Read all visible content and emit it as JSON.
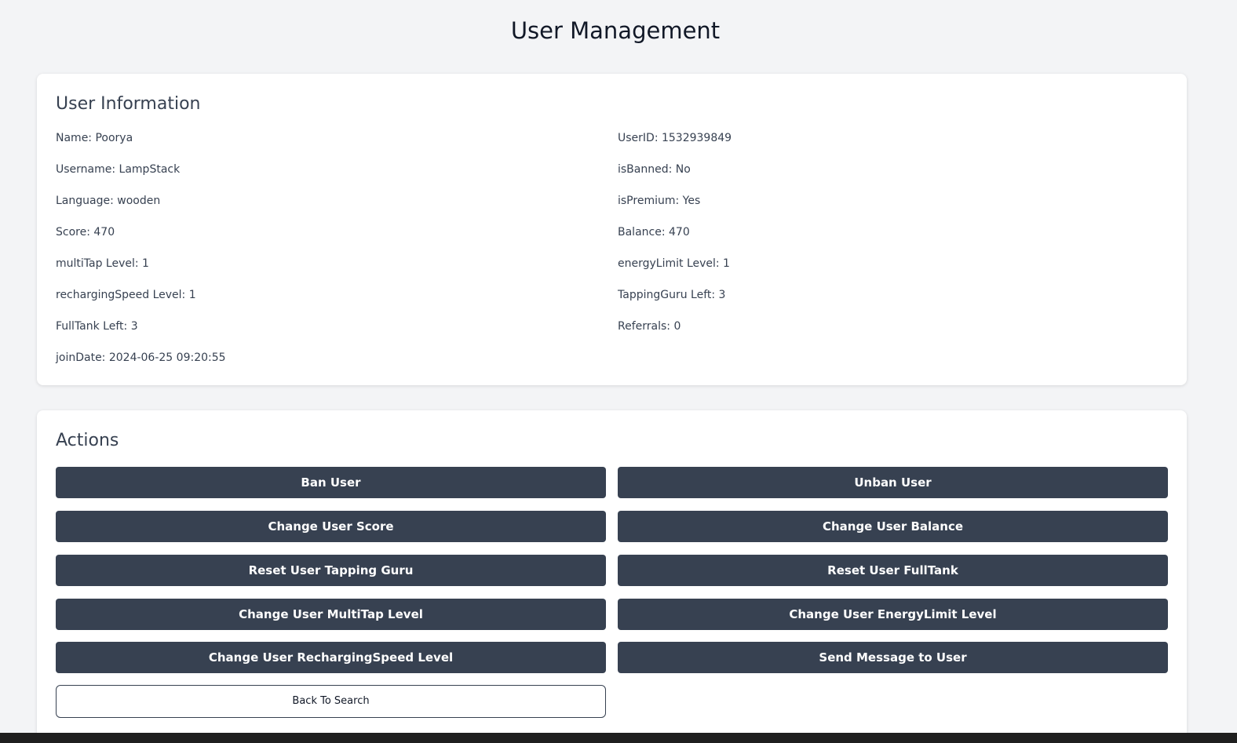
{
  "page": {
    "title": "User Management"
  },
  "user_info": {
    "heading": "User Information",
    "left": [
      "Name: Poorya",
      "Username: LampStack",
      "Language: wooden",
      "Score: 470",
      "multiTap Level: 1",
      "rechargingSpeed Level: 1",
      "FullTank Left: 3",
      "joinDate: 2024-06-25 09:20:55"
    ],
    "right": [
      "UserID: 1532939849",
      "isBanned: No",
      "isPremium: Yes",
      "Balance: 470",
      "energyLimit Level: 1",
      "TappingGuru Left: 3",
      "Referrals: 0"
    ]
  },
  "actions": {
    "heading": "Actions",
    "buttons": [
      "Ban User",
      "Unban User",
      "Change User Score",
      "Change User Balance",
      "Reset User Tapping Guru",
      "Reset User FullTank",
      "Change User MultiTap Level",
      "Change User EnergyLimit Level",
      "Change User RechargingSpeed Level",
      "Send Message to User"
    ],
    "back_label": "Back To Search"
  },
  "colors": {
    "background": "#f3f4f6",
    "card": "#ffffff",
    "button": "#374151",
    "button_text": "#ffffff"
  }
}
